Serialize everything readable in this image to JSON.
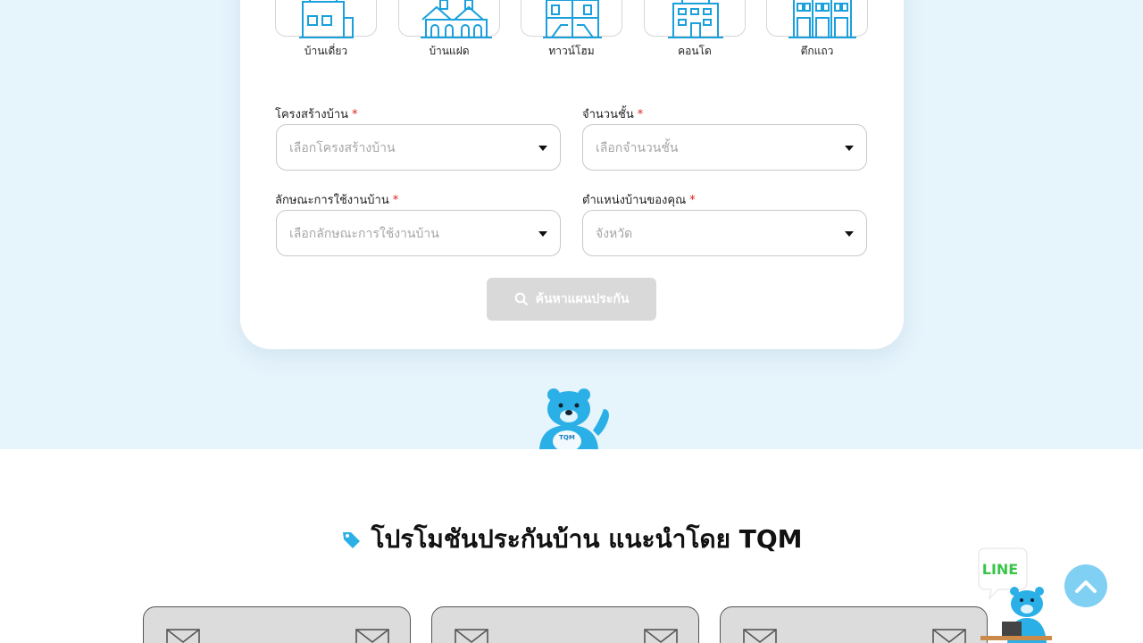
{
  "house_types": [
    {
      "label": "บ้านเดี่ยว",
      "icon": "single-house-icon"
    },
    {
      "label": "บ้านแฝด",
      "icon": "twin-house-icon"
    },
    {
      "label": "ทาวน์โฮม",
      "icon": "townhome-icon"
    },
    {
      "label": "คอนโด",
      "icon": "condo-icon"
    },
    {
      "label": "ตึกแถว",
      "icon": "shophouse-icon"
    }
  ],
  "form": {
    "structure": {
      "label": "โครงสร้างบ้าน",
      "required": "*",
      "placeholder": "เลือกโครงสร้างบ้าน"
    },
    "floors": {
      "label": "จำนวนชั้น",
      "required": "*",
      "placeholder": "เลือกจำนวนชั้น"
    },
    "usage": {
      "label": "ลักษณะการใช้งานบ้าน",
      "required": "*",
      "placeholder": "เลือกลักษณะการใช้งานบ้าน"
    },
    "location": {
      "label": "ตำแหน่งบ้านของคุณ",
      "required": "*",
      "placeholder": "จังหวัด"
    },
    "search_button": "ค้นหาแผนประกัน"
  },
  "mascot": {
    "badge": "TQM"
  },
  "promo": {
    "title": "โปรโมชันประกันบ้าน แนะนำโดย TQM"
  },
  "line_widget": {
    "label": "LINE"
  },
  "colors": {
    "accent": "#1aa0dc",
    "page_bg": "#e6f4fc",
    "button_disabled": "#d9d9d9",
    "required": "#e02020",
    "line_green": "#3ac549"
  }
}
